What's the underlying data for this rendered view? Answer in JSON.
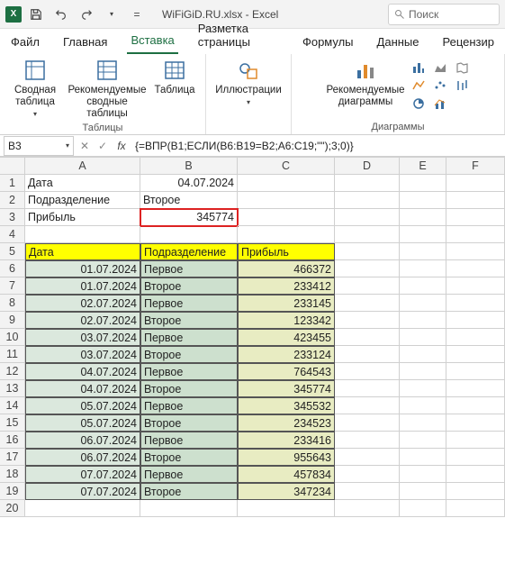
{
  "titlebar": {
    "app_name": "Excel",
    "filename": "WiFiGiD.RU.xlsx",
    "title_combined": "WiFiGiD.RU.xlsx - Excel",
    "search_placeholder": "Поиск"
  },
  "ribbon_tabs": {
    "file": "Файл",
    "home": "Главная",
    "insert": "Вставка",
    "layout": "Разметка страницы",
    "formulas": "Формулы",
    "data": "Данные",
    "review": "Рецензир"
  },
  "ribbon": {
    "pivot": "Сводная таблица",
    "recommended_pivot": "Рекомендуемые сводные таблицы",
    "table": "Таблица",
    "group_tables": "Таблицы",
    "illustrations": "Иллюстрации",
    "recommended_charts": "Рекомендуемые диаграммы",
    "group_charts": "Диаграммы"
  },
  "formula_bar": {
    "namebox": "B3",
    "fx": "fx",
    "formula": "{=ВПР(B1;ЕСЛИ(B6:B19=B2;A6:C19;\"\");3;0)}"
  },
  "grid": {
    "col_headers": [
      "A",
      "B",
      "C",
      "D",
      "E",
      "F"
    ],
    "rows": [
      {
        "n": "1",
        "A": "Дата",
        "B": "04.07.2024",
        "C": "",
        "D": "",
        "E": "",
        "F": ""
      },
      {
        "n": "2",
        "A": "Подразделение",
        "B": "Второе",
        "C": "",
        "D": "",
        "E": "",
        "F": ""
      },
      {
        "n": "3",
        "A": "Прибыль",
        "B": "345774",
        "C": "",
        "D": "",
        "E": "",
        "F": ""
      },
      {
        "n": "4",
        "A": "",
        "B": "",
        "C": "",
        "D": "",
        "E": "",
        "F": ""
      }
    ],
    "table_header": {
      "n": "5",
      "A": "Дата",
      "B": "Подразделение",
      "C": "Прибыль"
    },
    "table_rows": [
      {
        "n": "6",
        "A": "01.07.2024",
        "B": "Первое",
        "C": "466372"
      },
      {
        "n": "7",
        "A": "01.07.2024",
        "B": "Второе",
        "C": "233412"
      },
      {
        "n": "8",
        "A": "02.07.2024",
        "B": "Первое",
        "C": "233145"
      },
      {
        "n": "9",
        "A": "02.07.2024",
        "B": "Второе",
        "C": "123342"
      },
      {
        "n": "10",
        "A": "03.07.2024",
        "B": "Первое",
        "C": "423455"
      },
      {
        "n": "11",
        "A": "03.07.2024",
        "B": "Второе",
        "C": "233124"
      },
      {
        "n": "12",
        "A": "04.07.2024",
        "B": "Первое",
        "C": "764543"
      },
      {
        "n": "13",
        "A": "04.07.2024",
        "B": "Второе",
        "C": "345774"
      },
      {
        "n": "14",
        "A": "05.07.2024",
        "B": "Первое",
        "C": "345532"
      },
      {
        "n": "15",
        "A": "05.07.2024",
        "B": "Второе",
        "C": "234523"
      },
      {
        "n": "16",
        "A": "06.07.2024",
        "B": "Первое",
        "C": "233416"
      },
      {
        "n": "17",
        "A": "06.07.2024",
        "B": "Второе",
        "C": "955643"
      },
      {
        "n": "18",
        "A": "07.07.2024",
        "B": "Первое",
        "C": "457834"
      },
      {
        "n": "19",
        "A": "07.07.2024",
        "B": "Второе",
        "C": "347234"
      }
    ],
    "blank_row": {
      "n": "20"
    }
  }
}
